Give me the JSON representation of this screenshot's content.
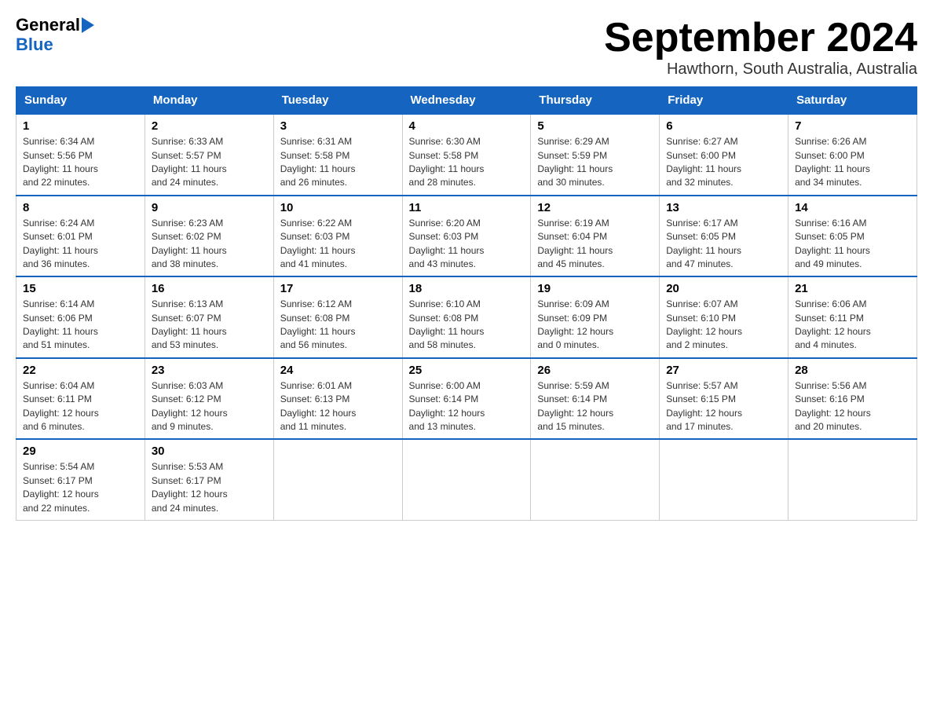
{
  "header": {
    "logo_general": "General",
    "logo_blue": "Blue",
    "month_title": "September 2024",
    "location": "Hawthorn, South Australia, Australia"
  },
  "days_of_week": [
    "Sunday",
    "Monday",
    "Tuesday",
    "Wednesday",
    "Thursday",
    "Friday",
    "Saturday"
  ],
  "weeks": [
    [
      {
        "day": "1",
        "sunrise": "6:34 AM",
        "sunset": "5:56 PM",
        "daylight": "11 hours and 22 minutes."
      },
      {
        "day": "2",
        "sunrise": "6:33 AM",
        "sunset": "5:57 PM",
        "daylight": "11 hours and 24 minutes."
      },
      {
        "day": "3",
        "sunrise": "6:31 AM",
        "sunset": "5:58 PM",
        "daylight": "11 hours and 26 minutes."
      },
      {
        "day": "4",
        "sunrise": "6:30 AM",
        "sunset": "5:58 PM",
        "daylight": "11 hours and 28 minutes."
      },
      {
        "day": "5",
        "sunrise": "6:29 AM",
        "sunset": "5:59 PM",
        "daylight": "11 hours and 30 minutes."
      },
      {
        "day": "6",
        "sunrise": "6:27 AM",
        "sunset": "6:00 PM",
        "daylight": "11 hours and 32 minutes."
      },
      {
        "day": "7",
        "sunrise": "6:26 AM",
        "sunset": "6:00 PM",
        "daylight": "11 hours and 34 minutes."
      }
    ],
    [
      {
        "day": "8",
        "sunrise": "6:24 AM",
        "sunset": "6:01 PM",
        "daylight": "11 hours and 36 minutes."
      },
      {
        "day": "9",
        "sunrise": "6:23 AM",
        "sunset": "6:02 PM",
        "daylight": "11 hours and 38 minutes."
      },
      {
        "day": "10",
        "sunrise": "6:22 AM",
        "sunset": "6:03 PM",
        "daylight": "11 hours and 41 minutes."
      },
      {
        "day": "11",
        "sunrise": "6:20 AM",
        "sunset": "6:03 PM",
        "daylight": "11 hours and 43 minutes."
      },
      {
        "day": "12",
        "sunrise": "6:19 AM",
        "sunset": "6:04 PM",
        "daylight": "11 hours and 45 minutes."
      },
      {
        "day": "13",
        "sunrise": "6:17 AM",
        "sunset": "6:05 PM",
        "daylight": "11 hours and 47 minutes."
      },
      {
        "day": "14",
        "sunrise": "6:16 AM",
        "sunset": "6:05 PM",
        "daylight": "11 hours and 49 minutes."
      }
    ],
    [
      {
        "day": "15",
        "sunrise": "6:14 AM",
        "sunset": "6:06 PM",
        "daylight": "11 hours and 51 minutes."
      },
      {
        "day": "16",
        "sunrise": "6:13 AM",
        "sunset": "6:07 PM",
        "daylight": "11 hours and 53 minutes."
      },
      {
        "day": "17",
        "sunrise": "6:12 AM",
        "sunset": "6:08 PM",
        "daylight": "11 hours and 56 minutes."
      },
      {
        "day": "18",
        "sunrise": "6:10 AM",
        "sunset": "6:08 PM",
        "daylight": "11 hours and 58 minutes."
      },
      {
        "day": "19",
        "sunrise": "6:09 AM",
        "sunset": "6:09 PM",
        "daylight": "12 hours and 0 minutes."
      },
      {
        "day": "20",
        "sunrise": "6:07 AM",
        "sunset": "6:10 PM",
        "daylight": "12 hours and 2 minutes."
      },
      {
        "day": "21",
        "sunrise": "6:06 AM",
        "sunset": "6:11 PM",
        "daylight": "12 hours and 4 minutes."
      }
    ],
    [
      {
        "day": "22",
        "sunrise": "6:04 AM",
        "sunset": "6:11 PM",
        "daylight": "12 hours and 6 minutes."
      },
      {
        "day": "23",
        "sunrise": "6:03 AM",
        "sunset": "6:12 PM",
        "daylight": "12 hours and 9 minutes."
      },
      {
        "day": "24",
        "sunrise": "6:01 AM",
        "sunset": "6:13 PM",
        "daylight": "12 hours and 11 minutes."
      },
      {
        "day": "25",
        "sunrise": "6:00 AM",
        "sunset": "6:14 PM",
        "daylight": "12 hours and 13 minutes."
      },
      {
        "day": "26",
        "sunrise": "5:59 AM",
        "sunset": "6:14 PM",
        "daylight": "12 hours and 15 minutes."
      },
      {
        "day": "27",
        "sunrise": "5:57 AM",
        "sunset": "6:15 PM",
        "daylight": "12 hours and 17 minutes."
      },
      {
        "day": "28",
        "sunrise": "5:56 AM",
        "sunset": "6:16 PM",
        "daylight": "12 hours and 20 minutes."
      }
    ],
    [
      {
        "day": "29",
        "sunrise": "5:54 AM",
        "sunset": "6:17 PM",
        "daylight": "12 hours and 22 minutes."
      },
      {
        "day": "30",
        "sunrise": "5:53 AM",
        "sunset": "6:17 PM",
        "daylight": "12 hours and 24 minutes."
      },
      null,
      null,
      null,
      null,
      null
    ]
  ],
  "labels": {
    "sunrise": "Sunrise:",
    "sunset": "Sunset:",
    "daylight": "Daylight:"
  }
}
